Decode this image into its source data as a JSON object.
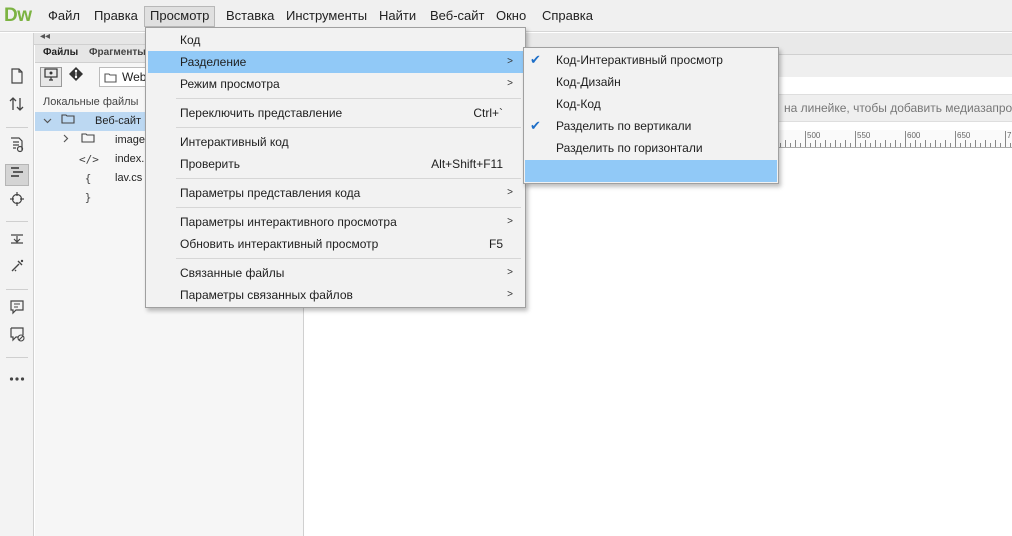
{
  "app": {
    "logo": "Dw"
  },
  "menubar": {
    "items": [
      {
        "label": "Файл"
      },
      {
        "label": "Правка"
      },
      {
        "label": "Просмотр"
      },
      {
        "label": "Вставка"
      },
      {
        "label": "Инструменты"
      },
      {
        "label": "Найти"
      },
      {
        "label": "Веб-сайт"
      },
      {
        "label": "Окно"
      },
      {
        "label": "Справка"
      }
    ],
    "active": "Просмотр"
  },
  "collapse_arrows": "◂◂",
  "files_panel": {
    "tabs": [
      "Файлы",
      "Фрагменты"
    ],
    "site_select": "Web",
    "local_files_label": "Локальные файлы",
    "tree": [
      {
        "name": "Веб-сайт",
        "icon": "folder-icon",
        "expanded": true,
        "selected": true
      },
      {
        "name": "image",
        "icon": "folder-icon",
        "expanded": false
      },
      {
        "name": "index.",
        "icon": "code-file-icon"
      },
      {
        "name": "lav.cs",
        "icon": "css-file-icon"
      }
    ]
  },
  "document": {
    "media_hint": "на линейке, чтобы добавить медиазапрос",
    "ruler_labels": [
      "500",
      "550",
      "600",
      "650",
      "7"
    ]
  },
  "view_menu": {
    "items": [
      {
        "label": "Код",
        "shortcut": "",
        "submenu": false
      },
      {
        "label": "Разделение",
        "shortcut": "",
        "submenu": true,
        "highlighted": true
      },
      {
        "label": "Режим просмотра",
        "shortcut": "",
        "submenu": true
      },
      {
        "label": "Переключить представление",
        "shortcut": "Ctrl+`",
        "submenu": false
      },
      {
        "label": "Интерактивный код",
        "shortcut": "",
        "submenu": false
      },
      {
        "label": "Проверить",
        "shortcut": "Alt+Shift+F11",
        "submenu": false
      },
      {
        "label": "Параметры представления кода",
        "shortcut": "",
        "submenu": true
      },
      {
        "label": "Параметры интерактивного просмотра",
        "shortcut": "",
        "submenu": true
      },
      {
        "label": "Обновить интерактивный просмотр",
        "shortcut": "F5",
        "submenu": false
      },
      {
        "label": "Связанные файлы",
        "shortcut": "",
        "submenu": true
      },
      {
        "label": "Параметры связанных файлов",
        "shortcut": "",
        "submenu": true
      }
    ]
  },
  "split_submenu": {
    "items": [
      {
        "label": "Код-Интерактивный просмотр",
        "checked": true
      },
      {
        "label": "Код-Дизайн",
        "checked": false
      },
      {
        "label": "Код-Код",
        "checked": false
      },
      {
        "label": "Разделить по вертикали",
        "checked": true
      },
      {
        "label": "Разделить по горизонтали",
        "checked": false
      },
      {
        "label": "",
        "checked": false,
        "highlighted": true
      }
    ]
  },
  "colors": {
    "accent": "#91c9f7",
    "logo": "#7cb342",
    "selection": "#bcd8f2"
  }
}
